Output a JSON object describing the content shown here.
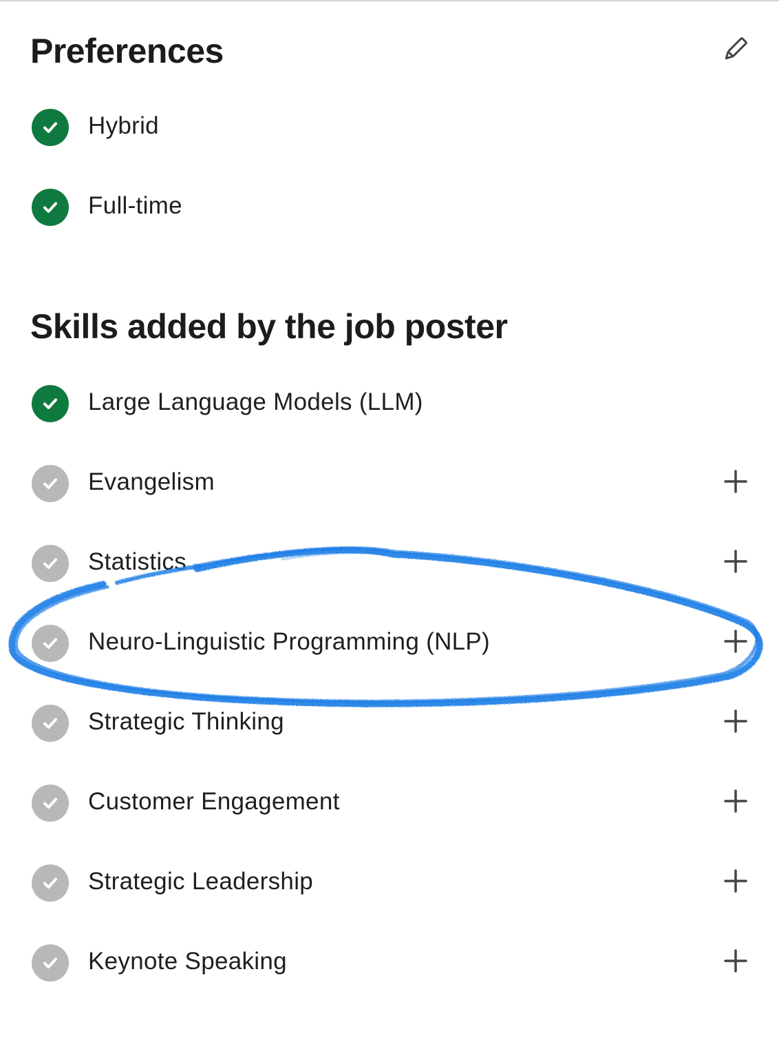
{
  "colors": {
    "checked": "#0f7a3f",
    "unchecked": "#b8b8b8",
    "annotation": "#1f7fe6",
    "icon": "#444444"
  },
  "preferences": {
    "title": "Preferences",
    "edit_icon": "pencil-icon",
    "items": [
      {
        "label": "Hybrid",
        "checked": true
      },
      {
        "label": "Full-time",
        "checked": true
      }
    ]
  },
  "skills": {
    "title": "Skills added by the job poster",
    "add_icon": "plus-icon",
    "items": [
      {
        "label": "Large Language Models (LLM)",
        "checked": true
      },
      {
        "label": "Evangelism",
        "checked": false
      },
      {
        "label": "Statistics",
        "checked": false
      },
      {
        "label": "Neuro-Linguistic Programming (NLP)",
        "checked": false,
        "circled": true
      },
      {
        "label": "Strategic Thinking",
        "checked": false
      },
      {
        "label": "Customer Engagement",
        "checked": false
      },
      {
        "label": "Strategic Leadership",
        "checked": false
      },
      {
        "label": "Keynote Speaking",
        "checked": false
      }
    ]
  }
}
